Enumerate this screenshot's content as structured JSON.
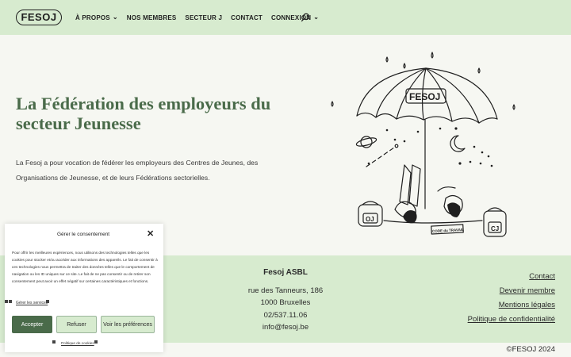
{
  "header": {
    "logo": "FESOJ",
    "nav": [
      {
        "label": "À PROPOS",
        "has_dropdown": true
      },
      {
        "label": "NOS MEMBRES",
        "has_dropdown": false
      },
      {
        "label": "SECTEUR J",
        "has_dropdown": false
      },
      {
        "label": "CONTACT",
        "has_dropdown": false
      },
      {
        "label": "CONNEXION",
        "has_dropdown": true
      }
    ],
    "search_icon": "search-icon"
  },
  "hero": {
    "title": "La Fédération des employeurs du secteur Jeunesse",
    "text": "La Fesoj a pour vocation de fédérer les employeurs des Centres de Jeunes, des Organisations de Jeunesse, et de leurs Fédérations sectorielles.",
    "illustration": {
      "umbrella_label": "FESOJ",
      "backpack_left": "OJ",
      "backpack_right": "CJ",
      "book_label": "CODE du TRAVAIL"
    }
  },
  "footer": {
    "org_name": "Fesoj ASBL",
    "address_line1": "rue des Tanneurs, 186",
    "address_line2": "1000 Bruxelles",
    "phone": "02/537.11.06",
    "email": "info@fesoj.be",
    "links": [
      "Contact",
      "Devenir membre",
      "Mentions légales",
      "Politique de confidentialité"
    ],
    "copyright": "©FESOJ 2024"
  },
  "consent": {
    "title": "Gérer le consentement",
    "body": "Pour offrir les meilleures expériences, nous utilisons des technologies telles que les cookies pour stocker et/ou accéder aux informations des appareils. Le fait de consentir à ces technologies nous permettra de traiter des données telles que le comportement de navigation ou les ID uniques sur ce site. Le fait de ne pas consentir ou de retirer son consentement peut avoir un effet négatif sur certaines caractéristiques et fonctions.",
    "manage_services": "Gérer les services",
    "accept": "Accepter",
    "refuse": "Refuser",
    "preferences": "Voir les préférences",
    "cookie_policy": "Politique de cookies"
  },
  "colors": {
    "header_bg": "#d7ebcf",
    "page_bg": "#f6f7f2",
    "title_green": "#4a6b4a",
    "accept_bg": "#4a6b4a"
  }
}
